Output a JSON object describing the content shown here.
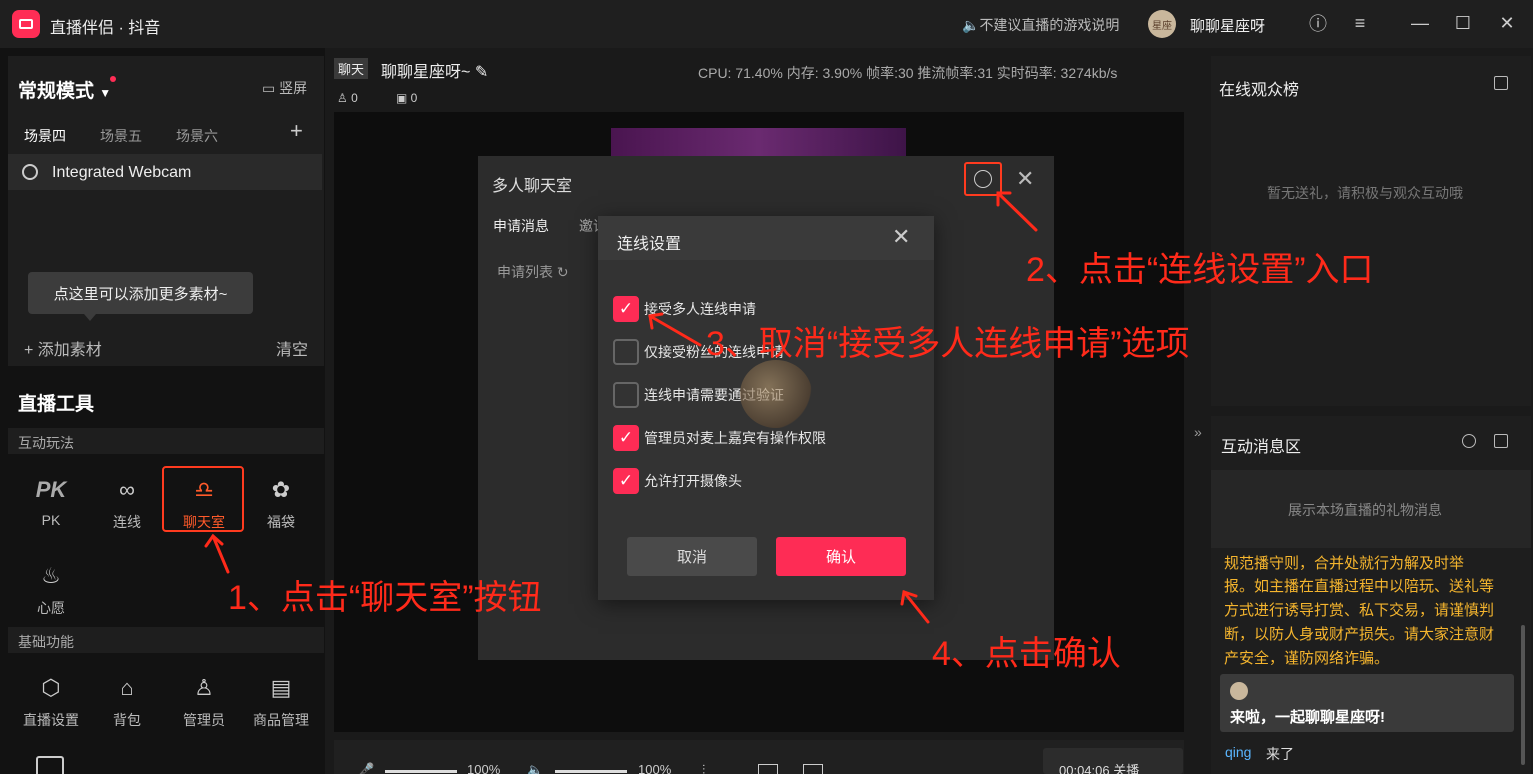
{
  "app": {
    "title": "直播伴侣 · 抖音",
    "notice": "不建议直播的游戏说明",
    "username": "聊聊星座呀",
    "avatar_text": "星座"
  },
  "left": {
    "mode": "常规模式",
    "vertical": "竖屏",
    "scene_tabs": [
      "场景四",
      "场景五",
      "场景六"
    ],
    "source": "Integrated Webcam",
    "tooltip": "点这里可以添加更多素材~",
    "add_material": "+ 添加素材",
    "clear": "清空",
    "tools_title": "直播工具",
    "section_interactive": "互动玩法",
    "interactive_tools": [
      "PK",
      "连线",
      "聊天室",
      "福袋",
      "心愿"
    ],
    "section_basic": "基础功能",
    "basic_tools": [
      "直播设置",
      "背包",
      "管理员",
      "商品管理"
    ]
  },
  "center": {
    "title_tag": "聊天",
    "stream_title": "聊聊星座呀~",
    "viewers": "0",
    "gifts": "0",
    "stats": "CPU: 71.40%   内存: 3.90%   帧率:30   推流帧率:31   实时码率: 3274kb/s",
    "mic_volume": "100%",
    "speaker_volume": "100%",
    "timer": "00:04:06 关播"
  },
  "chat_dialog": {
    "title": "多人聊天室",
    "tab_requests": "申请消息",
    "tab_invite": "邀请",
    "request_list": "申请列表"
  },
  "settings_dialog": {
    "title": "连线设置",
    "options": [
      {
        "label": "接受多人连线申请",
        "checked": true
      },
      {
        "label": "仅接受粉丝的连线申请",
        "checked": false
      },
      {
        "label": "连线申请需要通过验证",
        "checked": false
      },
      {
        "label": "管理员对麦上嘉宾有操作权限",
        "checked": true
      },
      {
        "label": "允许打开摄像头",
        "checked": true
      }
    ],
    "cancel": "取消",
    "confirm": "确认"
  },
  "annotations": {
    "step1": "1、点击“聊天室”按钮",
    "step2": "2、点击“连线设置”入口",
    "step3": "3、取消“接受多人连线申请”选项",
    "step4": "4、点击确认"
  },
  "right": {
    "audience_title": "在线观众榜",
    "audience_empty": "暂无送礼，请积极与观众互动哦",
    "msg_title": "互动消息区",
    "gift_empty": "展示本场直播的礼物消息",
    "warning_cut": "规范播守则，合并处就行为解及时举",
    "warning": "报。如主播在直播过程中以陪玩、送礼等方式进行诱导打赏、私下交易，请谨慎判断，以防人身或财产损失。请大家注意财产安全，谨防网络诈骗。",
    "host_msg": "来啦，一起聊聊星座呀!",
    "join_user": "qing",
    "join_text": "来了"
  },
  "colors": {
    "accent": "#fe2c55",
    "annotation": "#ff2a1a",
    "warning": "#f5b52e"
  }
}
